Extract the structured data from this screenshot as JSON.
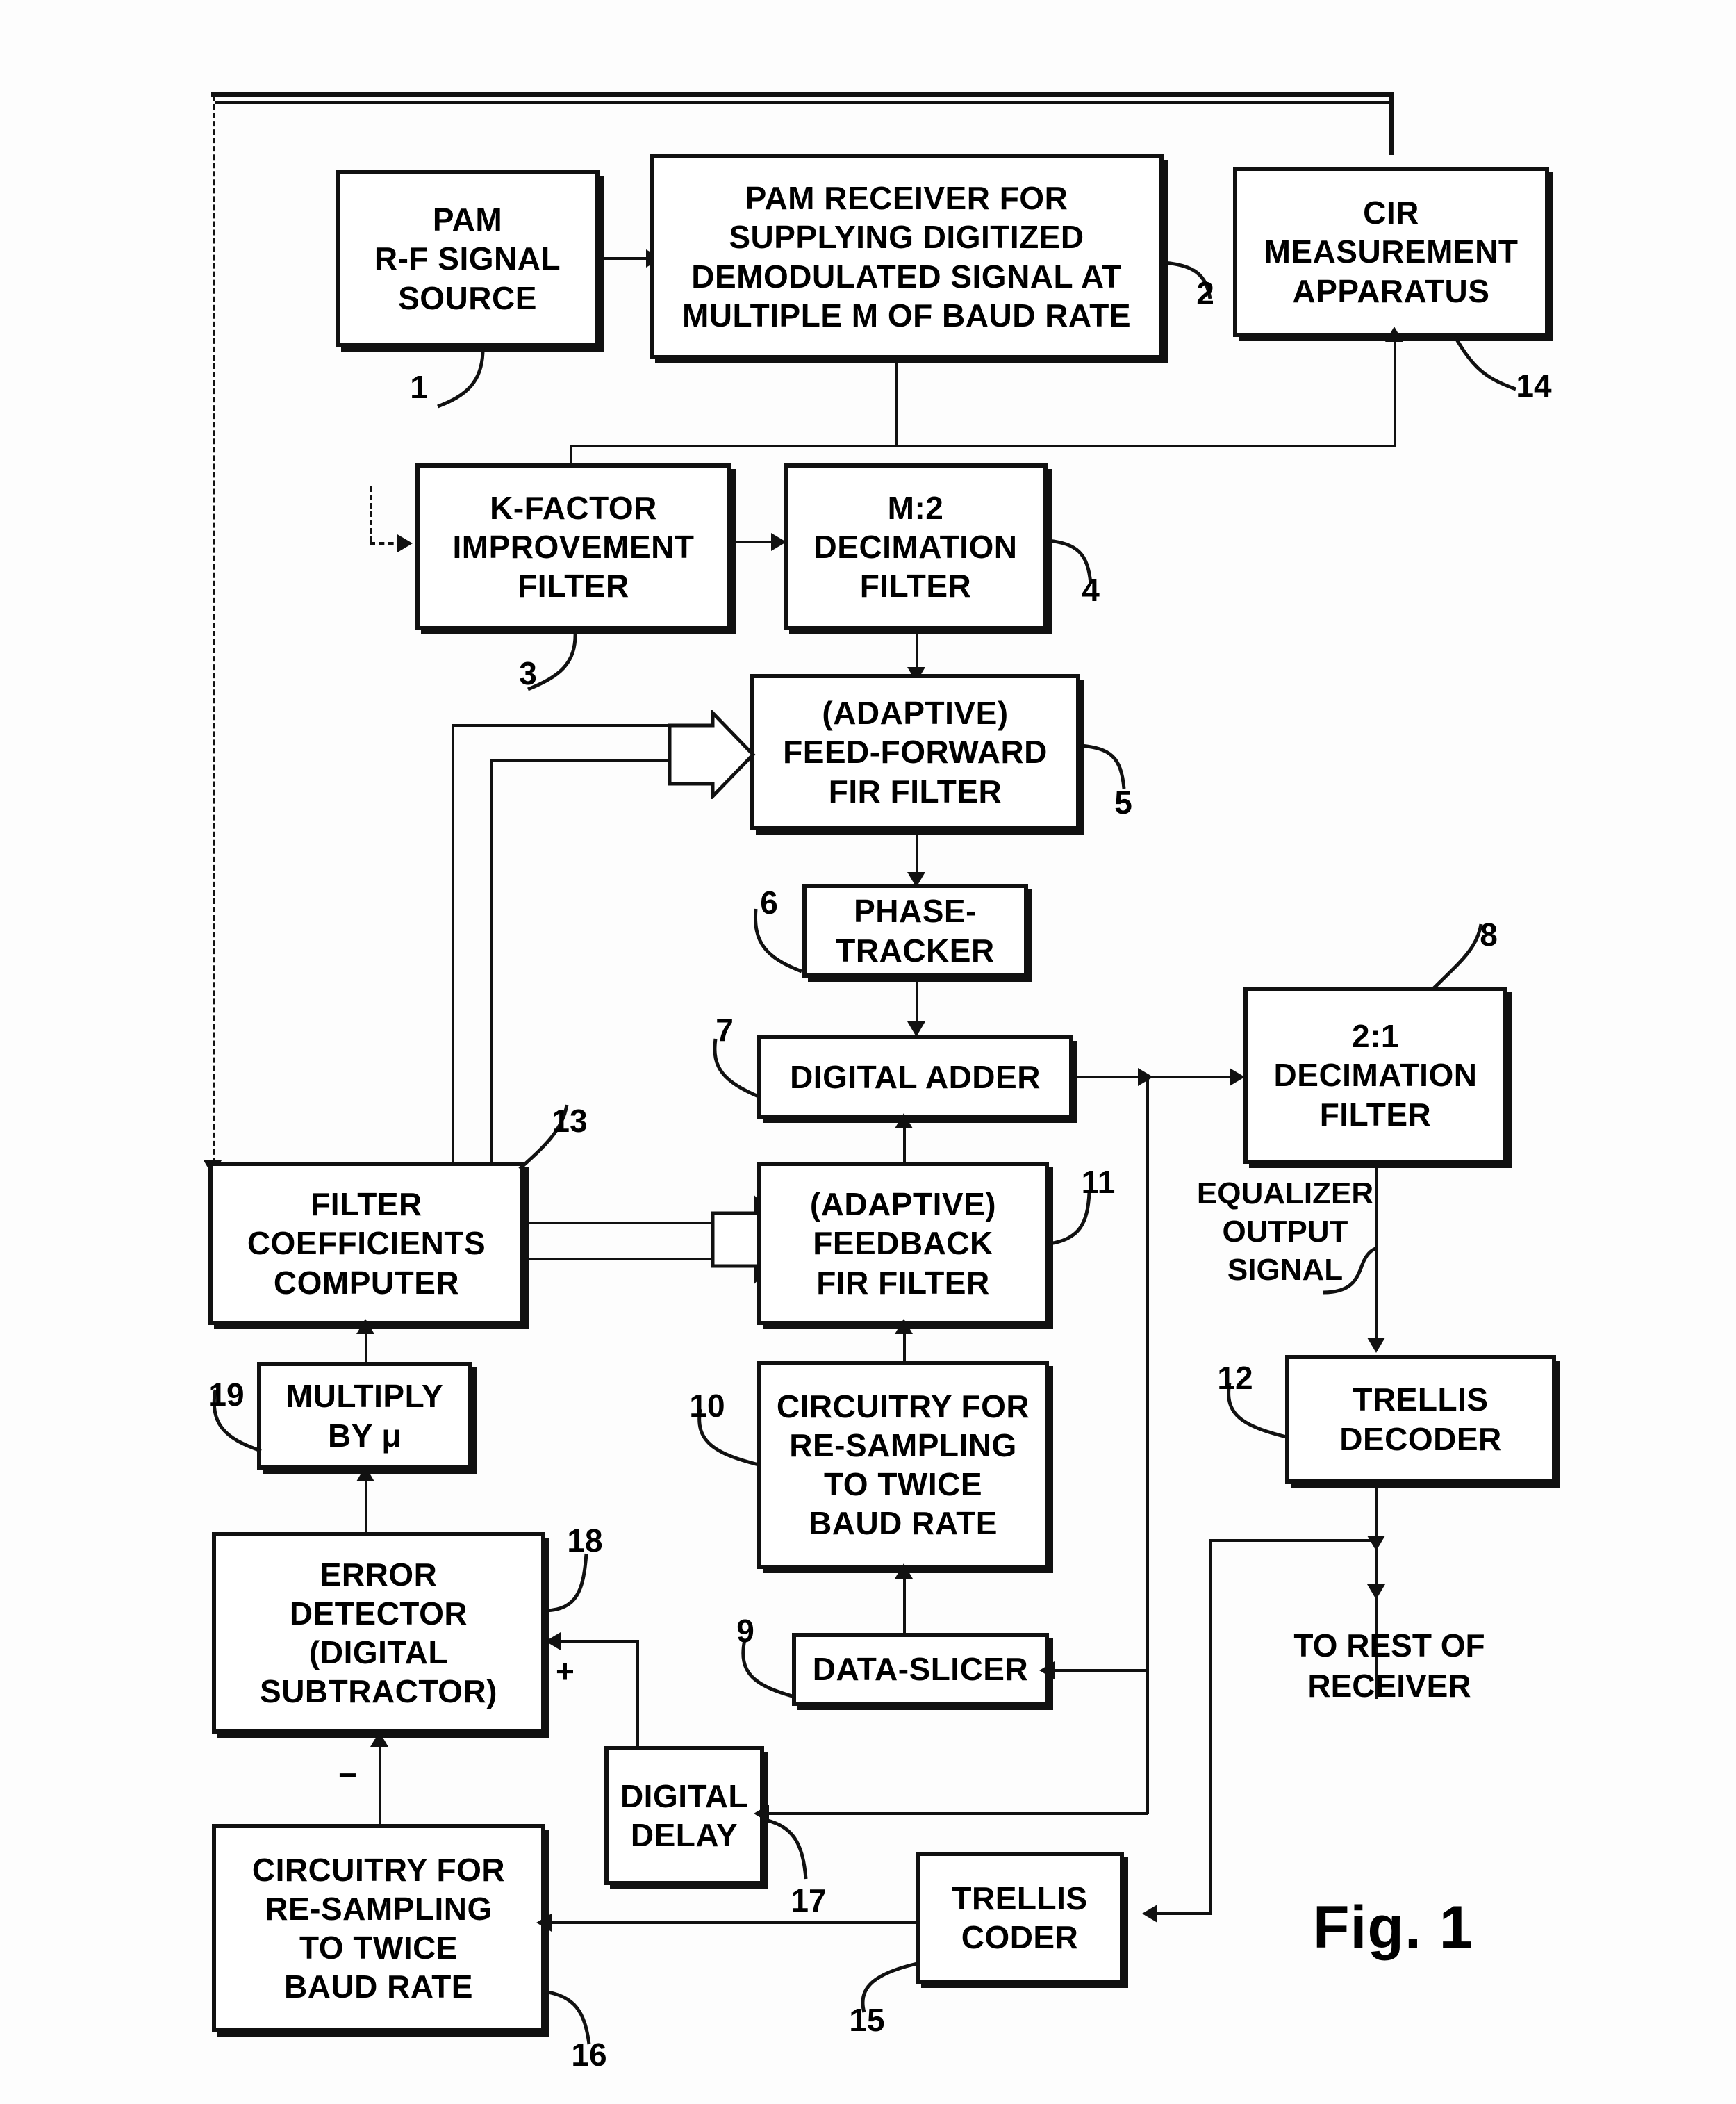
{
  "figure": {
    "label": "Fig. 1",
    "blocks": [
      {
        "id": "b1",
        "ref": "1",
        "text": "PAM\nR-F SIGNAL\nSOURCE"
      },
      {
        "id": "b2",
        "ref": "2",
        "text": "PAM RECEIVER FOR\nSUPPLYING DIGITIZED\nDEMODULATED SIGNAL AT\nMULTIPLE M OF BAUD RATE"
      },
      {
        "id": "b14",
        "ref": "14",
        "text": "CIR\nMEASUREMENT\nAPPARATUS"
      },
      {
        "id": "b3",
        "ref": "3",
        "text": "K-FACTOR\nIMPROVEMENT\nFILTER"
      },
      {
        "id": "b4",
        "ref": "4",
        "text": "M:2\nDECIMATION\nFILTER"
      },
      {
        "id": "b5",
        "ref": "5",
        "text": "(ADAPTIVE)\nFEED-FORWARD\nFIR FILTER"
      },
      {
        "id": "b6",
        "ref": "6",
        "text": "PHASE-\nTRACKER"
      },
      {
        "id": "b7",
        "ref": "7",
        "text": "DIGITAL ADDER"
      },
      {
        "id": "b8",
        "ref": "8",
        "text": "2:1\nDECIMATION\nFILTER"
      },
      {
        "id": "b13",
        "ref": "13",
        "text": "FILTER\nCOEFFICIENTS\nCOMPUTER"
      },
      {
        "id": "b11",
        "ref": "11",
        "text": "(ADAPTIVE)\nFEEDBACK\nFIR FILTER"
      },
      {
        "id": "b12",
        "ref": "12",
        "text": "TRELLIS\nDECODER"
      },
      {
        "id": "b19",
        "ref": "19",
        "text": "MULTIPLY\nBY  μ"
      },
      {
        "id": "b10",
        "ref": "10",
        "text": "CIRCUITRY FOR\nRE-SAMPLING\nTO TWICE\nBAUD RATE"
      },
      {
        "id": "b18",
        "ref": "18",
        "text": "ERROR\nDETECTOR\n(DIGITAL\nSUBTRACTOR)"
      },
      {
        "id": "b9",
        "ref": "9",
        "text": "DATA-SLICER"
      },
      {
        "id": "b17",
        "ref": "17",
        "text": "DIGITAL\nDELAY"
      },
      {
        "id": "b16",
        "ref": "16",
        "text": "CIRCUITRY FOR\nRE-SAMPLING\nTO TWICE\nBAUD RATE"
      },
      {
        "id": "b15",
        "ref": "15",
        "text": "TRELLIS\nCODER"
      }
    ],
    "annotations": {
      "equalizer_output": "EQUALIZER\nOUTPUT\nSIGNAL",
      "to_rest_of_receiver": "TO REST OF\nRECEIVER",
      "plus_sign": "+",
      "minus_sign": "−"
    }
  }
}
